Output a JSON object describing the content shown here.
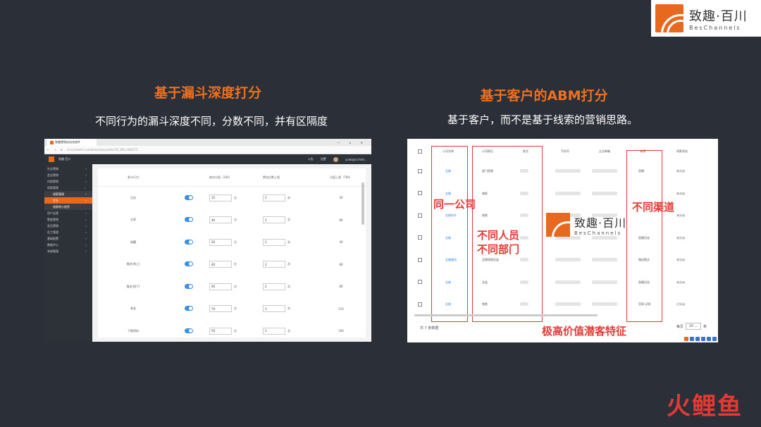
{
  "brand": {
    "name_cn": "致趣·百川",
    "name_en": "BesChannels"
  },
  "left": {
    "heading": "基于漏斗深度打分",
    "subheading": "不同行为的漏斗深度不同，分数不同，并有区隔度",
    "browser": {
      "tab_title": "致趣营销自动化软件",
      "window_controls": "— ▫ ✕",
      "address": "m.scrmtech.com/bes/index/index?ST_KEI=000271",
      "app_name": "致趣·百川",
      "top_links": [
        "公告",
        "设置"
      ],
      "user": "yulei@scrmte..."
    },
    "sidebar": [
      {
        "label": "社交营销",
        "arrow": "›"
      },
      {
        "label": "会议营销",
        "arrow": "›"
      },
      {
        "label": "内容营销",
        "arrow": "›"
      },
      {
        "label": "线索管理",
        "arrow": "⌄"
      },
      {
        "label": "线索管理",
        "arrow": "›"
      },
      {
        "label": "打分",
        "arrow": "›"
      },
      {
        "label": "线索转小程序",
        "arrow": ""
      },
      {
        "label": "用户运营",
        "arrow": "›"
      },
      {
        "label": "裂变营销",
        "arrow": "›"
      },
      {
        "label": "会员营销",
        "arrow": "›"
      },
      {
        "label": "员工管理",
        "arrow": "›"
      },
      {
        "label": "基础配置",
        "arrow": "›"
      },
      {
        "label": "数据中心",
        "arrow": "›"
      },
      {
        "label": "系统管理",
        "arrow": "›"
      }
    ],
    "table": {
      "headers": [
        "参与行为",
        "每次分值（340）",
        "累加分数上限",
        "分值上限（780）"
      ],
      "unit_score": "分",
      "unit_times": "次",
      "rows": [
        {
          "behavior": "点击",
          "score": "15",
          "times": "2",
          "max": "30"
        },
        {
          "behavior": "分享",
          "score": "40",
          "times": "2",
          "max": "80"
        },
        {
          "behavior": "收藏",
          "score": "20",
          "times": "2",
          "max": "40"
        },
        {
          "behavior": "报名(线上)",
          "score": "40",
          "times": "2",
          "max": "80"
        },
        {
          "behavior": "报名(线下)",
          "score": "40",
          "times": "2",
          "max": "80"
        },
        {
          "behavior": "参会",
          "score": "70",
          "times": "3",
          "max": "210"
        },
        {
          "behavior": "下载资料",
          "score": "50",
          "times": "2",
          "max": "100"
        }
      ]
    }
  },
  "right": {
    "heading": "基于客户的ABM打分",
    "subheading": "基于客户，而不是基于线索的营销思路。",
    "table": {
      "headers": [
        "公司名称",
        "公司职位",
        "姓名",
        "手机号",
        "企业邮箱",
        "来源",
        "线索状态"
      ],
      "rows": [
        {
          "company": "金蝶",
          "title": "部门经理",
          "source": "直播",
          "status": "未分派"
        },
        {
          "company": "金蝶",
          "title": "商醉",
          "source": "",
          "status": "未分派"
        },
        {
          "company": "金蝶软件",
          "title": "销售",
          "source": "",
          "status": "未分派"
        },
        {
          "company": "金蝶",
          "title": "",
          "source": "直播活动",
          "status": "未分派"
        },
        {
          "company": "金蝶集团",
          "title": "品牌经理总监",
          "source": "微信图文",
          "status": "未分派"
        },
        {
          "company": "金蝶",
          "title": "总监",
          "source": "直播活动",
          "status": "未分派"
        },
        {
          "company": "金蝶",
          "title": "销售",
          "source": "官网-试用",
          "status": "已分派"
        }
      ],
      "total": "共 7 条数据",
      "page_size_label": "每页",
      "page_size": "10",
      "page_suffix": "条"
    },
    "annotations": {
      "same_company": "同一公司",
      "diff_people": "不同人员",
      "diff_dept": "不同部门",
      "diff_channel": "不同渠道",
      "caption": "极高价值潜客特征"
    },
    "blurred_email_suffix": "KI..."
  },
  "watermark_bottom": "火鲤鱼",
  "colors": {
    "accent": "#f07020",
    "annotation": "#e53935",
    "toggle": "#3b8fe0",
    "background": "#2b2f37"
  }
}
